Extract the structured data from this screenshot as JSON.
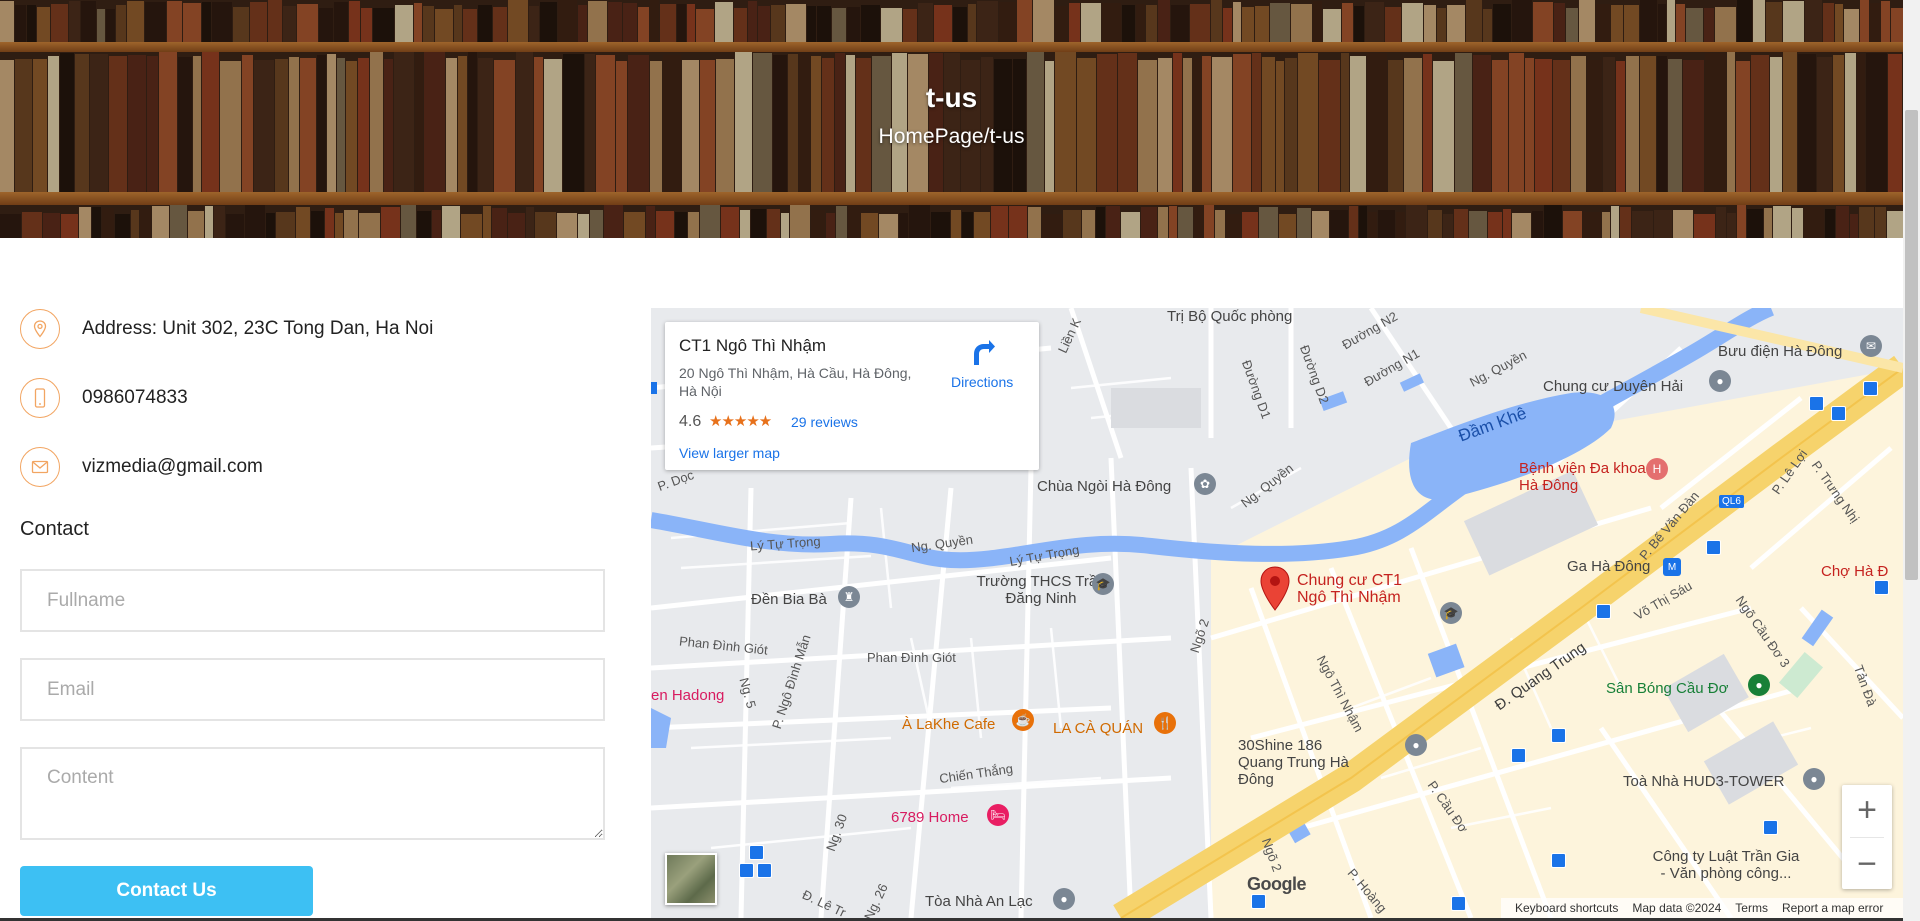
{
  "banner": {
    "title": "t-us",
    "breadcrumb": "HomePage/t-us"
  },
  "contact_info": {
    "address": "Address: Unit 302, 23C Tong Dan, Ha Noi",
    "phone": "0986074833",
    "email": "vizmedia@gmail.com",
    "icons": [
      "location-pin-icon",
      "mobile-phone-icon",
      "envelope-icon"
    ]
  },
  "form": {
    "heading": "Contact",
    "fullname_placeholder": "Fullname",
    "email_placeholder": "Email",
    "content_placeholder": "Content",
    "submit_label": "Contact Us",
    "accent_color": "#3dc0f3",
    "icon_color": "#f2a562"
  },
  "map": {
    "card": {
      "title": "CT1 Ngô Thì Nhậm",
      "address": "20 Ngô Thì Nhậm, Hà Cầu, Hà Đông, Hà Nội",
      "rating": "4.6",
      "stars": "★★★★★",
      "reviews": "29 reviews",
      "larger_map": "View larger map",
      "directions": "Directions"
    },
    "streets": {
      "ng_quyen_1": "Ng. Quyền",
      "ng_quyen_2": "Ng. Quyền",
      "ng_quyen_3": "Ng. Quyền",
      "ly_tu_trong_1": "Lý Tự Trọng",
      "ly_tu_trong_2": "Lý Tự Trọng",
      "phan_dinh_giot_1": "Phan Đình Giót",
      "phan_dinh_giot_2": "Phan Đình Giót",
      "p_ngo_dinh_man": "P. Ngô Đình Mẫn",
      "ng5": "Ng. 5",
      "ng30": "Ng. 30",
      "ng26": "Ng. 26",
      "chien_thang": "Chiến Thắng",
      "ngo2_a": "Ngõ 2",
      "ngo2_b": "Ngõ 2",
      "ngo_thi_nham": "Ngô Thì Nhậm",
      "p_cau_do": "P. Cầu Đơ",
      "d_quang_trung": "Đ. Quang Trung",
      "vo_thi_sau": "Võ Thị Sáu",
      "ngo_cau_do_3": "Ngõ Cầu Đơ 3",
      "p_be_van_dan": "P. Bế Văn Đàn",
      "p_le_loi": "P. Lê Lợi",
      "p_trung_nhi": "P. Trưng Nhị",
      "tan_da": "Tản Đà",
      "duong_d1": "Đường D1",
      "duong_d2": "Đường D2",
      "duong_n1": "Đường N1",
      "duong_n2": "Đường N2",
      "lien_k": "Liền K",
      "p_doc": "P. Dọc",
      "d_le_tr": "Đ. Lê Tr",
      "p_hoang": "P. Hoàng",
      "ql6": "QL6"
    },
    "pois": {
      "tri_bo_quoc_phong": "Trị Bộ Quốc phòng",
      "buu_dien": "Bưu điện Hà Đông",
      "chung_cu_duyen_hai": "Chung cư Duyên Hải",
      "dam_khe": "Đầm Khê",
      "benh_vien": "Bệnh viện Đa khoa Hà Đông",
      "chua_ngoi": "Chùa Ngòi Hà Đông",
      "ga_ha_dong": "Ga Hà Đông",
      "cho_ha_dong": "Chợ Hà Đ",
      "truong_thcs": "Trường THCS Trần Đăng Ninh",
      "den_bia_ba": "Đền Bia Bà",
      "chung_cu_ct1": "Chung cư CT1 Ngô Thì Nhậm",
      "san_bong": "Sân Bóng Cầu Đơ",
      "en_hadong": "en Hadong",
      "lakhe_cafe": "À LaKhe Cafe",
      "la_ca_quan": "LA CÀ QUÁN",
      "shine_30": "30Shine 186 Quang Trung Hà Đông",
      "toa_hud3": "Toà Nhà HUD3-TOWER",
      "home_6789": "6789 Home",
      "cong_ty_luat": "Công ty Luật Trần Gia - Văn phòng công...",
      "toa_an_lac": "Tòa Nhà An Lạc"
    },
    "controls": {
      "zoom_in": "+",
      "zoom_out": "−"
    },
    "attribution": {
      "google": "Google",
      "shortcuts": "Keyboard shortcuts",
      "map_data": "Map data ©2024",
      "terms": "Terms",
      "report": "Report a map error"
    }
  }
}
